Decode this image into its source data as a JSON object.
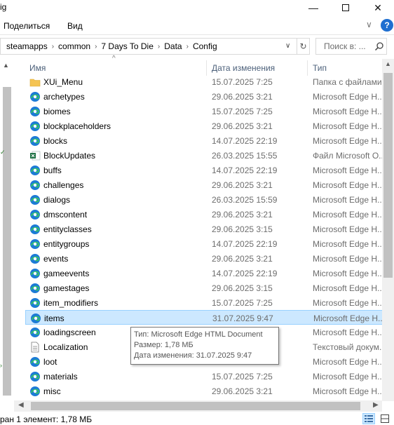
{
  "window": {
    "title_fragment": "ig",
    "minimize_glyph": "—",
    "close_glyph": "✕"
  },
  "ribbon": {
    "tabs": [
      {
        "label": "Поделиться"
      },
      {
        "label": "Вид"
      }
    ],
    "collapse_glyph": "∨",
    "help_glyph": "?"
  },
  "address": {
    "crumbs": [
      {
        "label": "steamapps"
      },
      {
        "label": "common"
      },
      {
        "label": "7 Days To Die"
      },
      {
        "label": "Data"
      },
      {
        "label": "Config"
      }
    ],
    "separator": "›",
    "dropdown_glyph": "∨",
    "refresh_glyph": "↻"
  },
  "search": {
    "placeholder": "Поиск в: ..."
  },
  "columns": {
    "name": "Имя",
    "date": "Дата изменения",
    "type": "Тип"
  },
  "files": [
    {
      "name": "XUi_Menu",
      "date": "15.07.2025 7:25",
      "type": "Папка с файлами",
      "icon": "folder-icon"
    },
    {
      "name": "archetypes",
      "date": "29.06.2025 3:21",
      "type": "Microsoft Edge H...",
      "icon": "edge-icon"
    },
    {
      "name": "biomes",
      "date": "15.07.2025 7:25",
      "type": "Microsoft Edge H...",
      "icon": "edge-icon"
    },
    {
      "name": "blockplaceholders",
      "date": "29.06.2025 3:21",
      "type": "Microsoft Edge H...",
      "icon": "edge-icon"
    },
    {
      "name": "blocks",
      "date": "14.07.2025 22:19",
      "type": "Microsoft Edge H...",
      "icon": "edge-icon"
    },
    {
      "name": "BlockUpdates",
      "date": "26.03.2025 15:55",
      "type": "Файл Microsoft O...",
      "icon": "excel-icon"
    },
    {
      "name": "buffs",
      "date": "14.07.2025 22:19",
      "type": "Microsoft Edge H...",
      "icon": "edge-icon"
    },
    {
      "name": "challenges",
      "date": "29.06.2025 3:21",
      "type": "Microsoft Edge H...",
      "icon": "edge-icon"
    },
    {
      "name": "dialogs",
      "date": "26.03.2025 15:59",
      "type": "Microsoft Edge H...",
      "icon": "edge-icon"
    },
    {
      "name": "dmscontent",
      "date": "29.06.2025 3:21",
      "type": "Microsoft Edge H...",
      "icon": "edge-icon"
    },
    {
      "name": "entityclasses",
      "date": "29.06.2025 3:15",
      "type": "Microsoft Edge H...",
      "icon": "edge-icon"
    },
    {
      "name": "entitygroups",
      "date": "14.07.2025 22:19",
      "type": "Microsoft Edge H...",
      "icon": "edge-icon"
    },
    {
      "name": "events",
      "date": "29.06.2025 3:21",
      "type": "Microsoft Edge H...",
      "icon": "edge-icon"
    },
    {
      "name": "gameevents",
      "date": "14.07.2025 22:19",
      "type": "Microsoft Edge H...",
      "icon": "edge-icon"
    },
    {
      "name": "gamestages",
      "date": "29.06.2025 3:15",
      "type": "Microsoft Edge H...",
      "icon": "edge-icon"
    },
    {
      "name": "item_modifiers",
      "date": "15.07.2025 7:25",
      "type": "Microsoft Edge H...",
      "icon": "edge-icon"
    },
    {
      "name": "items",
      "date": "31.07.2025 9:47",
      "type": "Microsoft Edge H...",
      "icon": "edge-icon",
      "selected": true
    },
    {
      "name": "loadingscreen",
      "date": "",
      "type": "Microsoft Edge H...",
      "icon": "edge-icon"
    },
    {
      "name": "Localization",
      "date": "",
      "type": "Текстовый докум...",
      "icon": "text-file-icon"
    },
    {
      "name": "loot",
      "date": "",
      "type": "Microsoft Edge H...",
      "icon": "edge-icon"
    },
    {
      "name": "materials",
      "date": "15.07.2025 7:25",
      "type": "Microsoft Edge H...",
      "icon": "edge-icon"
    },
    {
      "name": "misc",
      "date": "29.06.2025 3:21",
      "type": "Microsoft Edge H...",
      "icon": "edge-icon"
    }
  ],
  "tooltip": {
    "type_line": "Тип: Microsoft Edge HTML Document",
    "size_line": "Размер: 1,78 МБ",
    "date_line": "Дата изменения: 31.07.2025 9:47"
  },
  "status": {
    "text": "ран 1 элемент: 1,78 МБ"
  },
  "colors": {
    "selection_bg": "#cce8ff",
    "selection_border": "#99d1ff",
    "edge_blue": "#1c7bd6",
    "edge_green": "#35c06b",
    "folder_yellow": "#f5c453",
    "excel_green": "#1e7145"
  }
}
